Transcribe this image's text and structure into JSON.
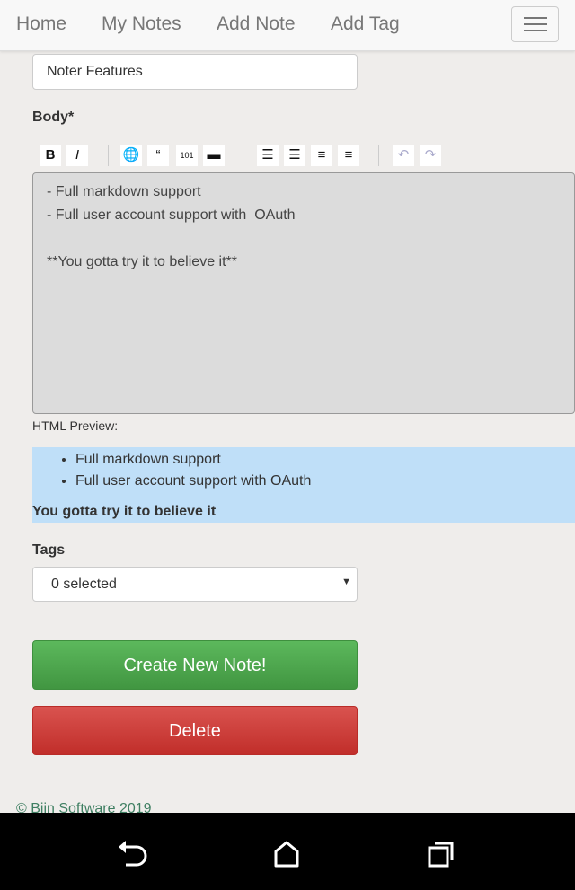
{
  "nav": {
    "items": [
      "Home",
      "My Notes",
      "Add Note",
      "Add Tag"
    ]
  },
  "form": {
    "title_value": "Noter Features",
    "body_label": "Body*",
    "toolbar": [
      {
        "icon": "bold-icon",
        "glyph": "B"
      },
      {
        "icon": "italic-icon",
        "glyph": "I"
      },
      {
        "icon": "link-icon",
        "glyph": "🌐"
      },
      {
        "icon": "quote-icon",
        "glyph": "“"
      },
      {
        "icon": "code-icon",
        "glyph": "101"
      },
      {
        "icon": "image-icon",
        "glyph": "▬"
      },
      {
        "icon": "ordered-list-icon",
        "glyph": "☰"
      },
      {
        "icon": "unordered-list-icon",
        "glyph": "☰"
      },
      {
        "icon": "heading-icon",
        "glyph": "≡"
      },
      {
        "icon": "horizontal-rule-icon",
        "glyph": "≡"
      },
      {
        "icon": "undo-icon",
        "glyph": "↶"
      },
      {
        "icon": "redo-icon",
        "glyph": "↷"
      }
    ],
    "body_value": "- Full markdown support\n- Full user account support with  OAuth\n\n**You gotta try it to believe it**",
    "preview_label": "HTML Preview:",
    "preview": {
      "items": [
        "Full markdown support",
        "Full user account support with OAuth"
      ],
      "bold": "You gotta try it to believe it"
    },
    "tags_label": "Tags",
    "tags_value": "0 selected",
    "create_label": "Create New Note!",
    "delete_label": "Delete"
  },
  "footer": "© Biin Software 2019"
}
